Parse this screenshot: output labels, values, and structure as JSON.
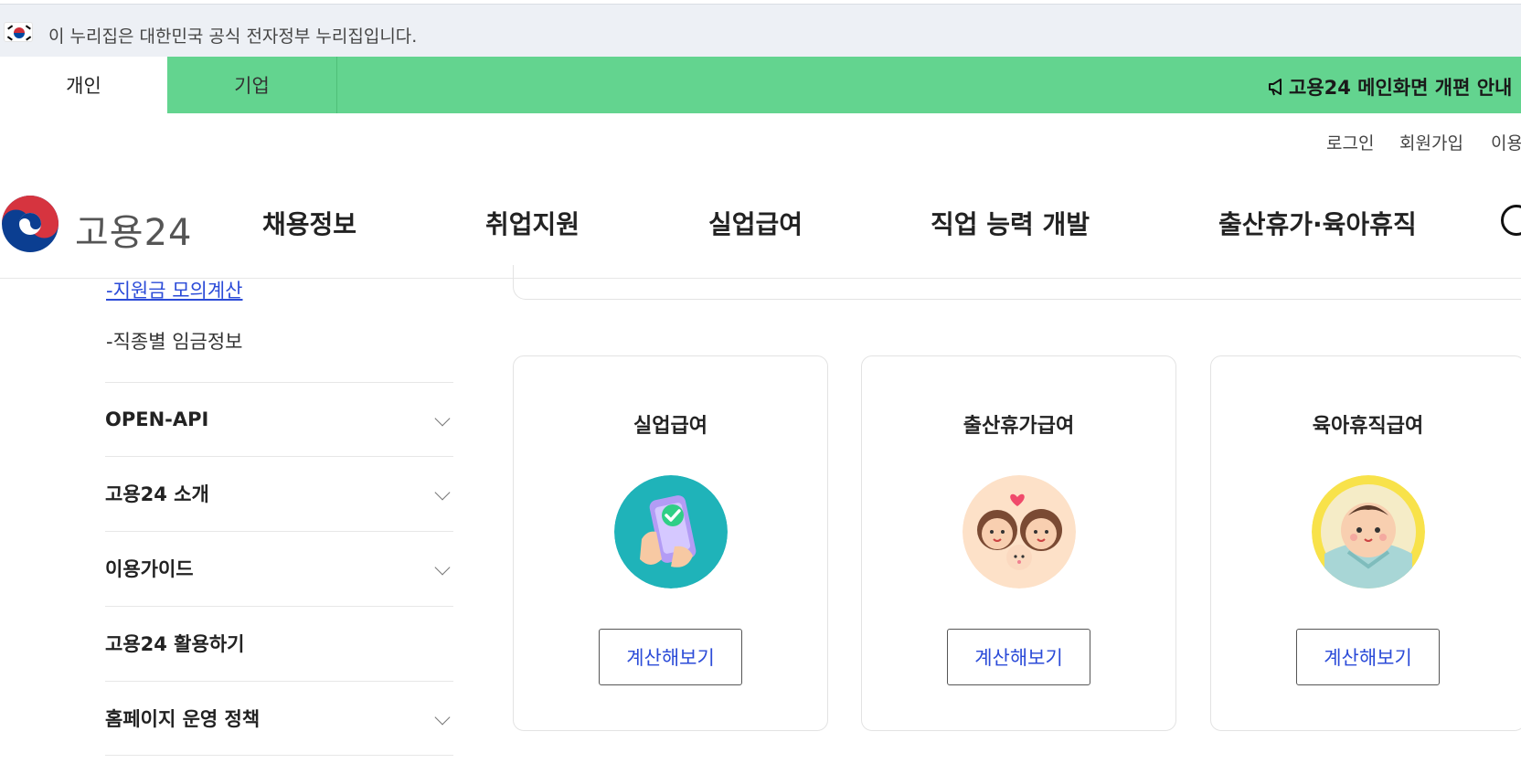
{
  "gov_banner": {
    "text": "이 누리집은 대한민국 공식 전자정부 누리집입니다."
  },
  "tabs": {
    "personal": "개인",
    "corporate": "기업"
  },
  "notice": {
    "text": "고용24 메인화면 개편 안내"
  },
  "utility": {
    "login": "로그인",
    "signup": "회원가입",
    "guide": "이용"
  },
  "logo": {
    "text": "고용24"
  },
  "nav": [
    "채용정보",
    "취업지원",
    "실업급여",
    "직업 능력 개발",
    "출산휴가·육아휴직"
  ],
  "sidebar": {
    "sub_links": [
      "-지원금 모의계산",
      "-직종별 임금정보"
    ],
    "sections": [
      "OPEN-API",
      "고용24 소개",
      "이용가이드",
      "고용24 활용하기",
      "홈페이지 운영 정책"
    ]
  },
  "cards": [
    {
      "title": "실업급여",
      "button": "계산해보기",
      "icon": "phone-check-icon",
      "color": "#1fb3b9"
    },
    {
      "title": "출산휴가급여",
      "button": "계산해보기",
      "icon": "family-icon",
      "color": "#fde1c8"
    },
    {
      "title": "육아휴직급여",
      "button": "계산해보기",
      "icon": "baby-icon",
      "color": "#f8e24a"
    }
  ],
  "colors": {
    "accent_green": "#63d48f",
    "link_blue": "#2b4bd8"
  }
}
